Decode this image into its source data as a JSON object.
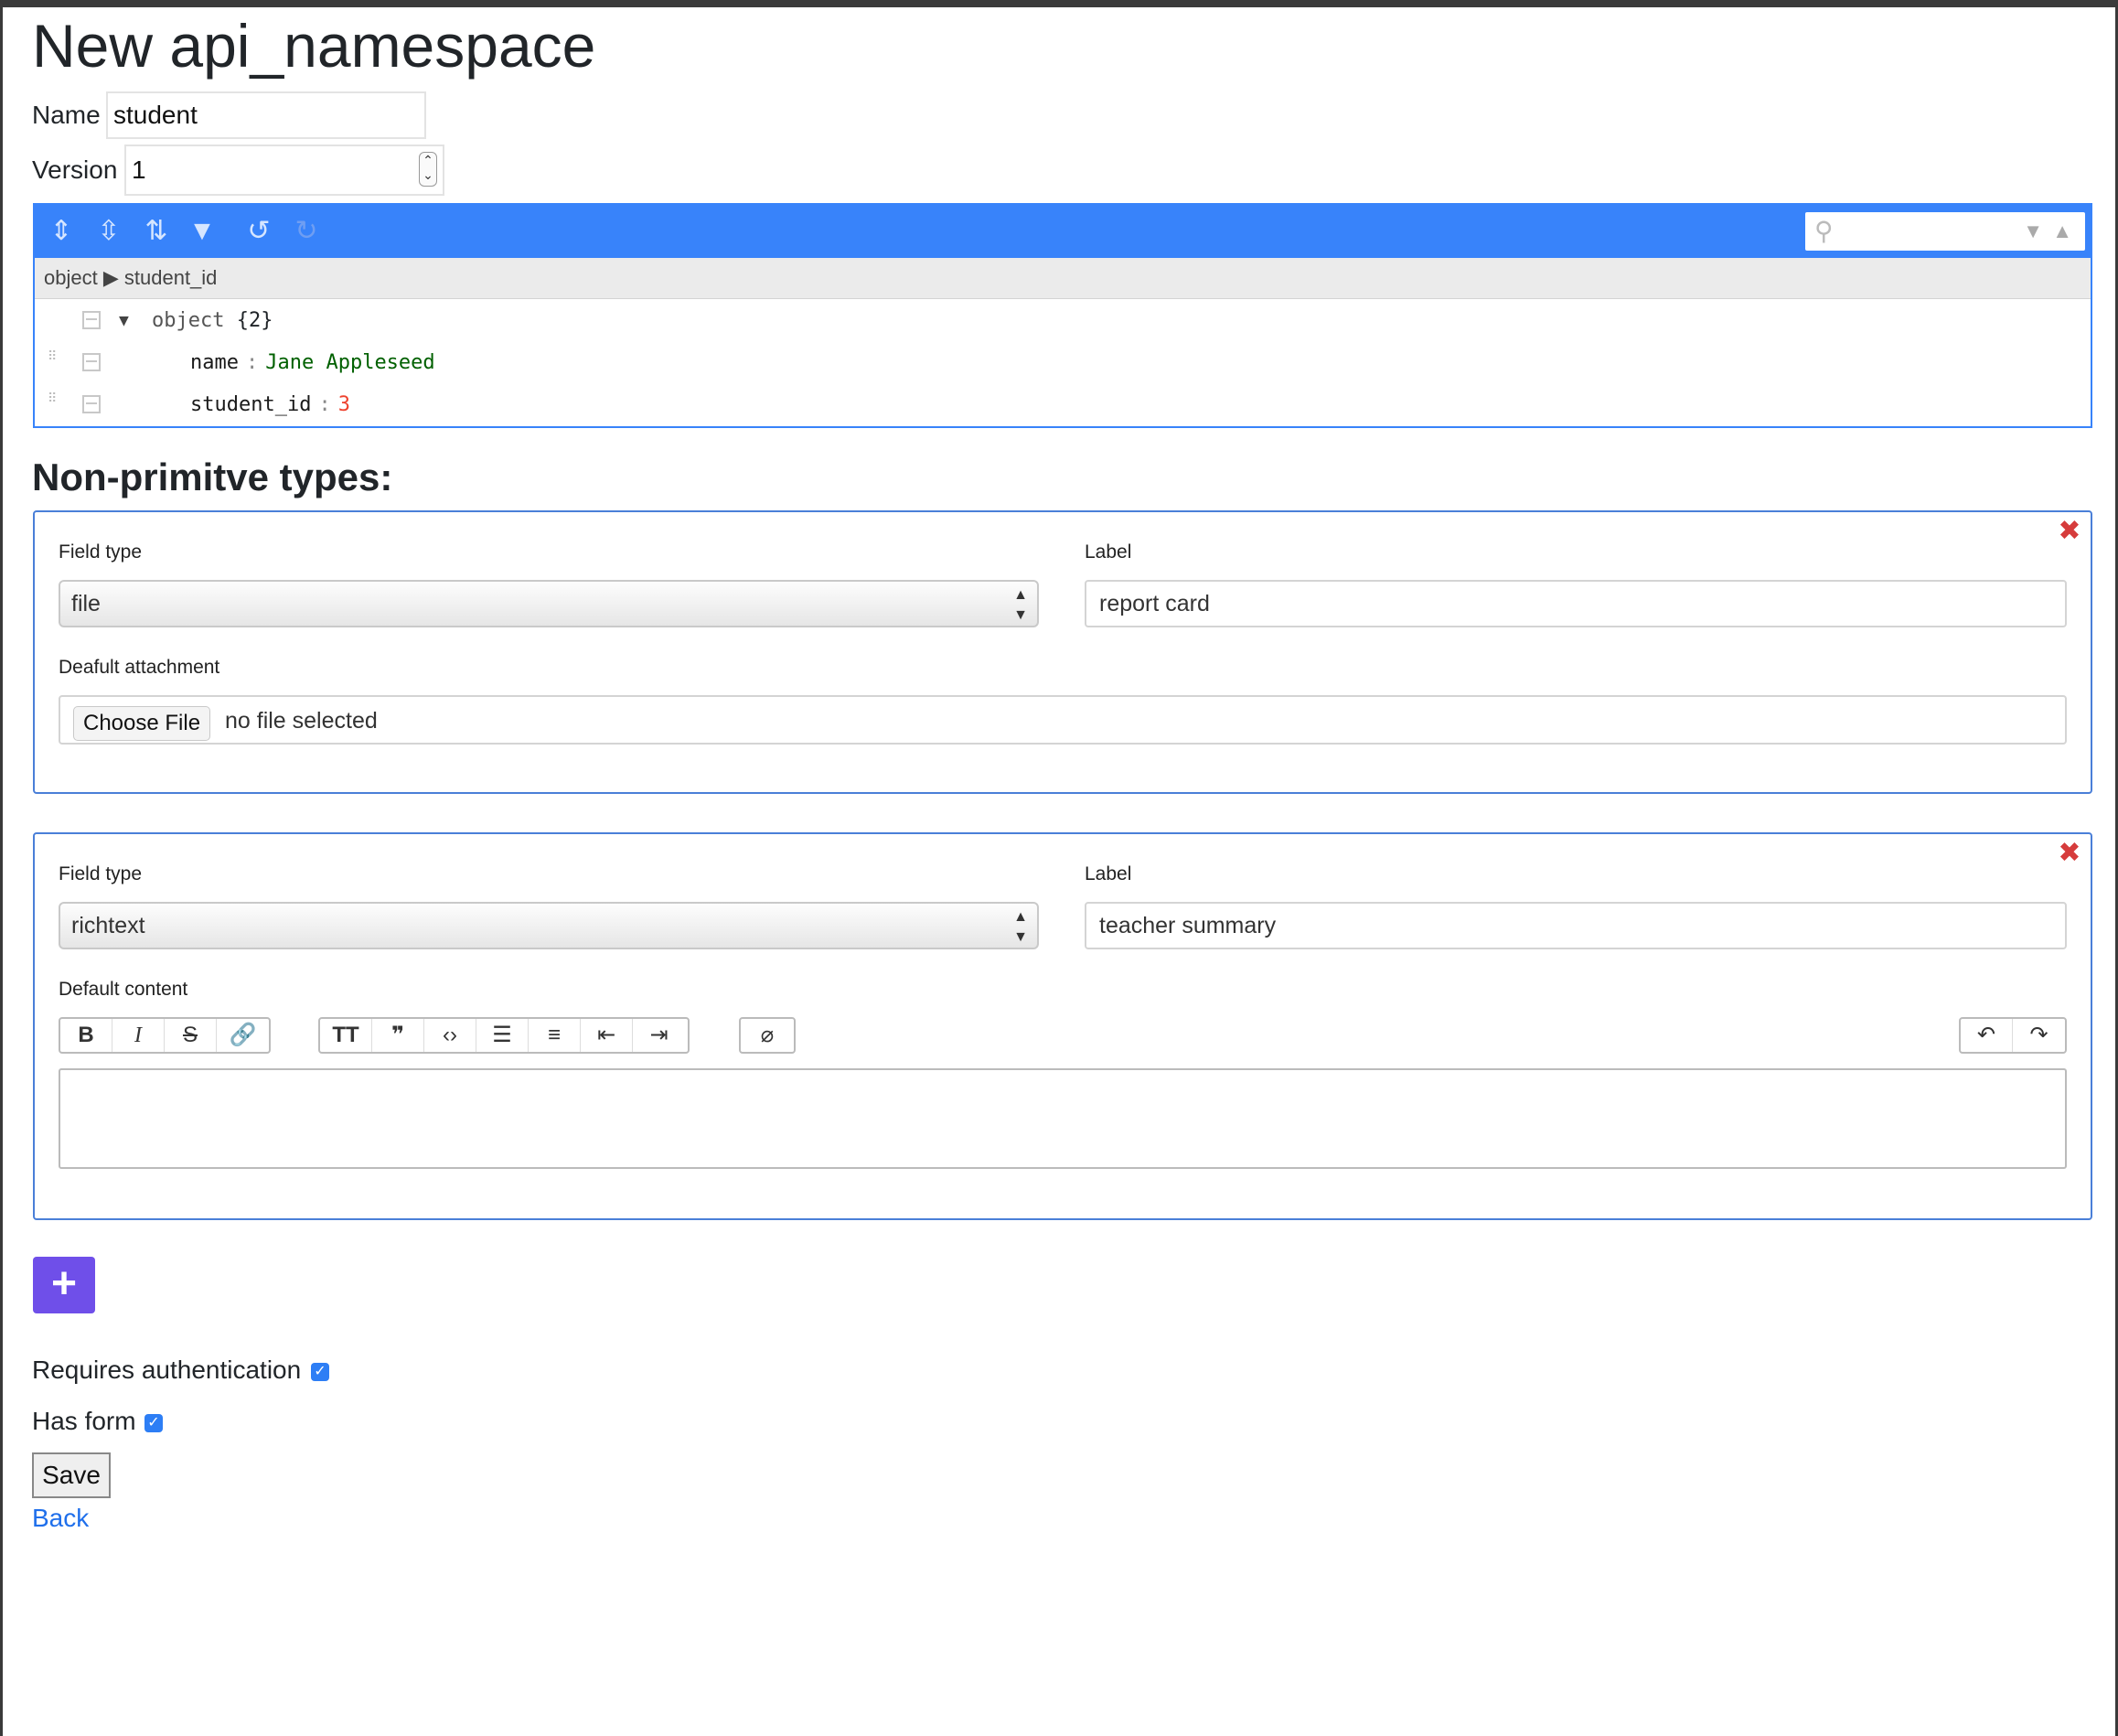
{
  "page": {
    "title": "New api_namespace"
  },
  "form": {
    "name_label": "Name",
    "name_value": "student",
    "version_label": "Version",
    "version_value": "1"
  },
  "json_editor": {
    "breadcrumb": {
      "root": "object",
      "separator": "▶",
      "current": "student_id"
    },
    "root_row": {
      "type": "object",
      "count": "{2}"
    },
    "fields": [
      {
        "key": "name",
        "separator": ":",
        "value": "Jane Appleseed",
        "value_type": "string"
      },
      {
        "key": "student_id",
        "separator": ":",
        "value": "3",
        "value_type": "number"
      }
    ]
  },
  "section_title": "Non-primitve types:",
  "cards": [
    {
      "field_type_label": "Field type",
      "field_type_value": "file",
      "label_label": "Label",
      "label_value": "report card",
      "attachment_label": "Deafult attachment",
      "choose_file": "Choose File",
      "no_file": "no file selected"
    },
    {
      "field_type_label": "Field type",
      "field_type_value": "richtext",
      "label_label": "Label",
      "label_value": "teacher summary",
      "content_label": "Default content",
      "toolbar_icons": [
        "bold-icon",
        "italic-icon",
        "strike-icon",
        "link-icon",
        "heading-icon",
        "quote-icon",
        "code-icon",
        "bullet-list-icon",
        "number-list-icon",
        "outdent-icon",
        "indent-icon",
        "attach-icon",
        "undo-icon",
        "redo-icon"
      ]
    }
  ],
  "add_button": "+",
  "requires_auth": {
    "label": "Requires authentication",
    "checked": true
  },
  "has_form": {
    "label": "Has form",
    "checked": true
  },
  "save_label": "Save",
  "back_label": "Back",
  "colors": {
    "editor_blue": "#3883fa",
    "card_border": "#4a7fd8",
    "add_button": "#6f4fe9",
    "remove_red": "#d63c3c",
    "link": "#1f6feb"
  }
}
